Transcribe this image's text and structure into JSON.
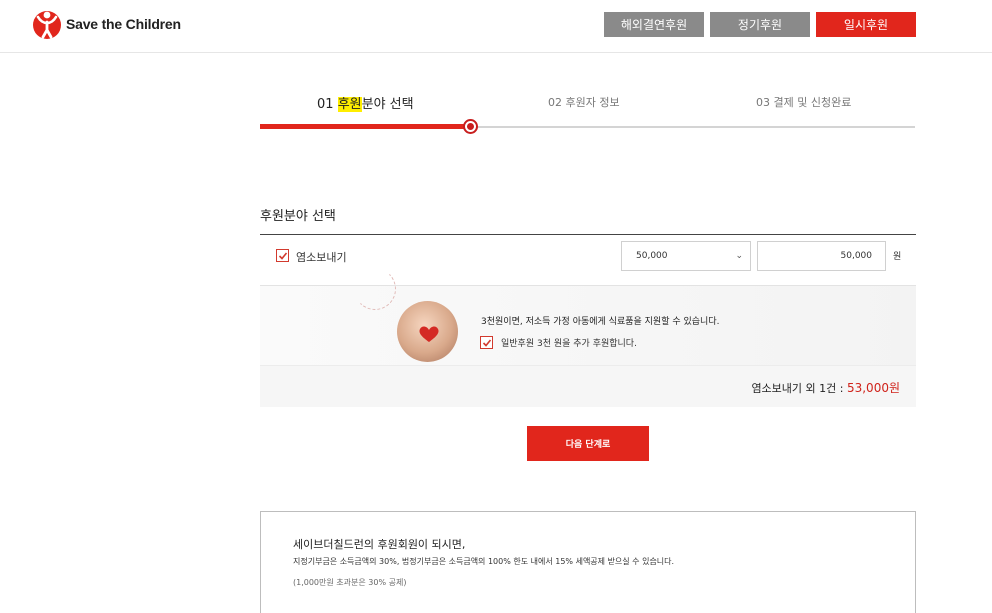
{
  "header": {
    "logo_text": "Save the Children",
    "buttons": [
      {
        "label": "해외결연후원",
        "style": "gray"
      },
      {
        "label": "정기후원",
        "style": "gray"
      },
      {
        "label": "일시후원",
        "style": "red"
      }
    ]
  },
  "steps": [
    {
      "num": "01",
      "highlight": "후원",
      "rest": "분야 선택",
      "active": true
    },
    {
      "label": "02 후원자 정보",
      "active": false
    },
    {
      "label": "03 결제 및 신청완료",
      "active": false
    }
  ],
  "section": {
    "title": "후원분야 선택",
    "item": {
      "checked": true,
      "label": "염소보내기",
      "selected_amount": "50,000",
      "amount_value": "50,000",
      "currency": "원"
    }
  },
  "promo": {
    "text": "3천원이면, 저소득 가정 아동에게 식료품을 지원할 수 있습니다.",
    "extra_checked": true,
    "extra_label": "일반후원 3천 원을 추가 후원합니다."
  },
  "total": {
    "label": "염소보내기 외 1건 : ",
    "value": "53,000원"
  },
  "next_button": "다음 단계로",
  "info": {
    "title": "세이브더칠드런의 후원회원이 되시면,",
    "desc": "지정기부금은 소득금액의 30%, 법정기부금은 소득금액의 100% 한도 내에서 15% 세액공제 받으실 수 있습니다.",
    "note": "(1,000만원 초과분은 30% 공제)"
  },
  "colors": {
    "brand_red": "#e1261c",
    "gray_button": "#8a8a8a",
    "highlight": "#ffee00"
  }
}
